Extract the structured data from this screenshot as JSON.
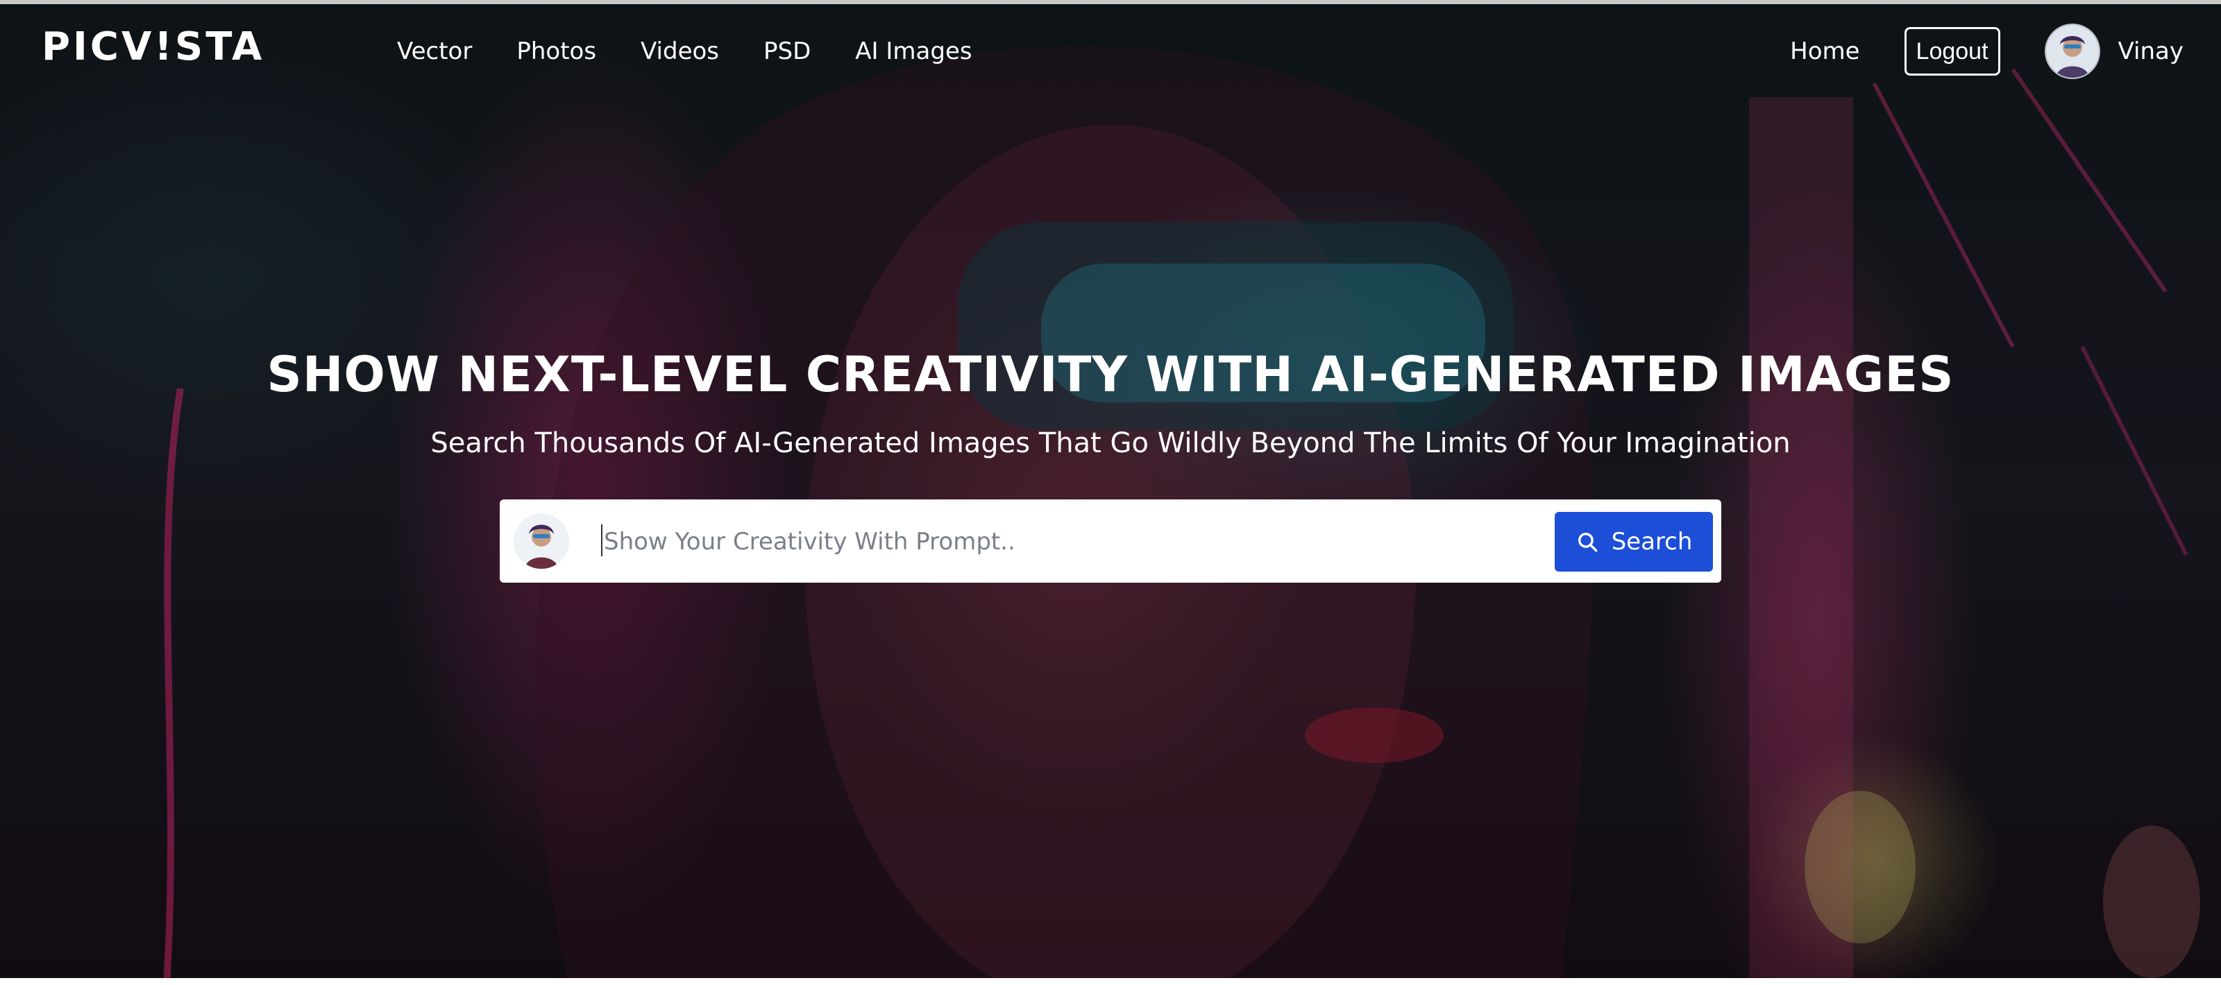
{
  "brand": {
    "logo_text": "PICV!STA"
  },
  "nav": {
    "items": [
      {
        "label": "Vector"
      },
      {
        "label": "Photos"
      },
      {
        "label": "Videos"
      },
      {
        "label": "PSD"
      },
      {
        "label": "AI Images"
      }
    ]
  },
  "header_right": {
    "home_label": "Home",
    "logout_label": "Logout",
    "user_name": "Vinay"
  },
  "hero": {
    "title": "SHOW NEXT-LEVEL CREATIVITY WITH AI-GENERATED IMAGES",
    "subtitle": "Search Thousands Of AI-Generated Images That Go Wildly Beyond The Limits Of Your Imagination"
  },
  "search": {
    "placeholder": "Show Your Creativity With Prompt..",
    "value": "",
    "button_label": "Search"
  },
  "colors": {
    "accent": "#1d4ed8",
    "text_light": "#ffffff"
  },
  "icons": {
    "search": "search-icon",
    "avatar": "avatar"
  }
}
